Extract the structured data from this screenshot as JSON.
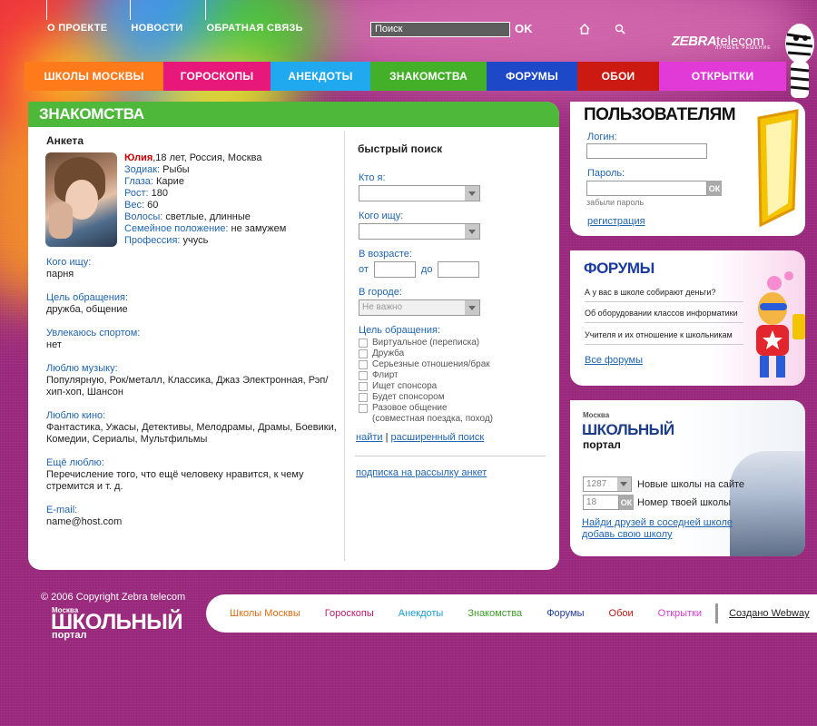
{
  "colors": {
    "background": "#9b2a7e",
    "accent_green": "#4db83a",
    "link_blue": "#2065b0",
    "name_red": "#cc0000"
  },
  "top_nav": {
    "links": [
      "О ПРОЕКТЕ",
      "НОВОСТИ",
      "ОБРАТНАЯ СВЯЗЬ"
    ],
    "search_value": "Поиск",
    "search_ok": "OK",
    "icons": [
      "home-icon",
      "search-icon"
    ]
  },
  "logo": {
    "brand_bold": "ZEBRA",
    "brand_rest": "telecom",
    "tagline": "ЛУЧШЕЕ РЕШЕНИЕ"
  },
  "main_menu": [
    {
      "label": "ШКОЛЫ МОСКВЫ",
      "color": "#ff7a1a"
    },
    {
      "label": "ГОРОСКОПЫ",
      "color": "#e8177a"
    },
    {
      "label": "АНЕКДОТЫ",
      "color": "#21a9f0"
    },
    {
      "label": "ЗНАКОМСТВА",
      "color": "#44b02a"
    },
    {
      "label": "ФОРУМЫ",
      "color": "#1d48c8"
    },
    {
      "label": "ОБОИ",
      "color": "#cc1a12"
    },
    {
      "label": "ОТКРЫТКИ",
      "color": "#e23ad6"
    }
  ],
  "main": {
    "header": "ЗНАКОМСТВА",
    "profile_title": "Анкета",
    "profile": {
      "name": "Юлия",
      "summary": ",18 лет, Россия, Москва",
      "rows": [
        {
          "k": "Зодиак:",
          "v": " Рыбы"
        },
        {
          "k": "Глаза:",
          "v": " Карие"
        },
        {
          "k": "Рост:",
          "v": " 180"
        },
        {
          "k": "Вес:",
          "v": " 60"
        },
        {
          "k": "Волосы:",
          "v": " светлые, длинные"
        },
        {
          "k": "Семейное положение:",
          "v": " не замужем"
        },
        {
          "k": "Профессия:",
          "v": " учусь"
        }
      ]
    },
    "fields": [
      {
        "label": "Кого ищу:",
        "value": "парня"
      },
      {
        "label": "Цель обращения:",
        "value": "дружба, общение"
      },
      {
        "label": "Увлекаюсь спортом:",
        "value": "нет"
      },
      {
        "label": "Люблю музыку:",
        "value": "Популярную, Рок/металл, Классика, Джаз Электронная, Рэп/хип-хоп, Шансон"
      },
      {
        "label": "Люблю кино:",
        "value": "Фантастика, Ужасы, Детективы, Мелодрамы, Драмы, Боевики, Комедии, Сериалы, Мультфильмы"
      },
      {
        "label": "Ещё люблю:",
        "value": "Перечисление того, что ещё человеку нравится, к чему стремится и т. д."
      },
      {
        "label": "E-mail:",
        "value": "name@host.com"
      }
    ]
  },
  "quick_search": {
    "title": "быстрый поиск",
    "who_am_i": "Кто я:",
    "who_seek": "Кого ищу:",
    "age_label": "В возрасте:",
    "age_from": "от",
    "age_to": "до",
    "city_label": "В городе:",
    "city_value": "Не важно",
    "goal_label": "Цель обращения:",
    "goals": [
      "Виртуальное (переписка)",
      "Дружба",
      "Серьезные отношения/брак",
      "Флирт",
      "Ищет спонсора",
      "Будет спонсором",
      "Разовое общение\n(совместная поездка, поход)"
    ],
    "find": "найти",
    "sep": " | ",
    "advanced": "расширенный поиск",
    "subscribe": "подписка на рассылку анкет"
  },
  "users": {
    "title": "ПОЛЬЗОВАТЕЛЯМ",
    "login": "Логин:",
    "password": "Пароль:",
    "ok": "ОК",
    "forgot": "забыли пароль",
    "register": "регистрация"
  },
  "forums": {
    "title": "ФОРУМЫ",
    "items": [
      "А у вас в школе собирают деньги?",
      "Об оборудовании классов информатики",
      "Учителя и их отношение к школьникам"
    ],
    "all": "Все форумы"
  },
  "portal": {
    "city": "Москва",
    "name": "ШКОЛЬНЫЙ",
    "sub": "портал",
    "new_schools_value": "1287",
    "new_schools_label": "Новые школы на сайте",
    "school_no_value": "18",
    "ok": "ОК",
    "school_no_label": "Номер твоей школы",
    "find_friends": "Найди друзей в соседней школе",
    "add_school": "добавь свою школу"
  },
  "footer": {
    "copyright": "© 2006 Copyright Zebra telecom",
    "city": "Москва",
    "name": "ШКОЛЬНЫЙ",
    "sub": "портал",
    "links": [
      {
        "label": "Школы Москвы",
        "color": "#e06d12"
      },
      {
        "label": "Гороскопы",
        "color": "#c0166b"
      },
      {
        "label": "Анекдоты",
        "color": "#1ca0d8"
      },
      {
        "label": "Знакомства",
        "color": "#3c9a24"
      },
      {
        "label": "Форумы",
        "color": "#1d3a9a"
      },
      {
        "label": "Обои",
        "color": "#c0160f"
      },
      {
        "label": "Открытки",
        "color": "#d63ad0"
      }
    ],
    "made_by": "Создано Webway"
  }
}
